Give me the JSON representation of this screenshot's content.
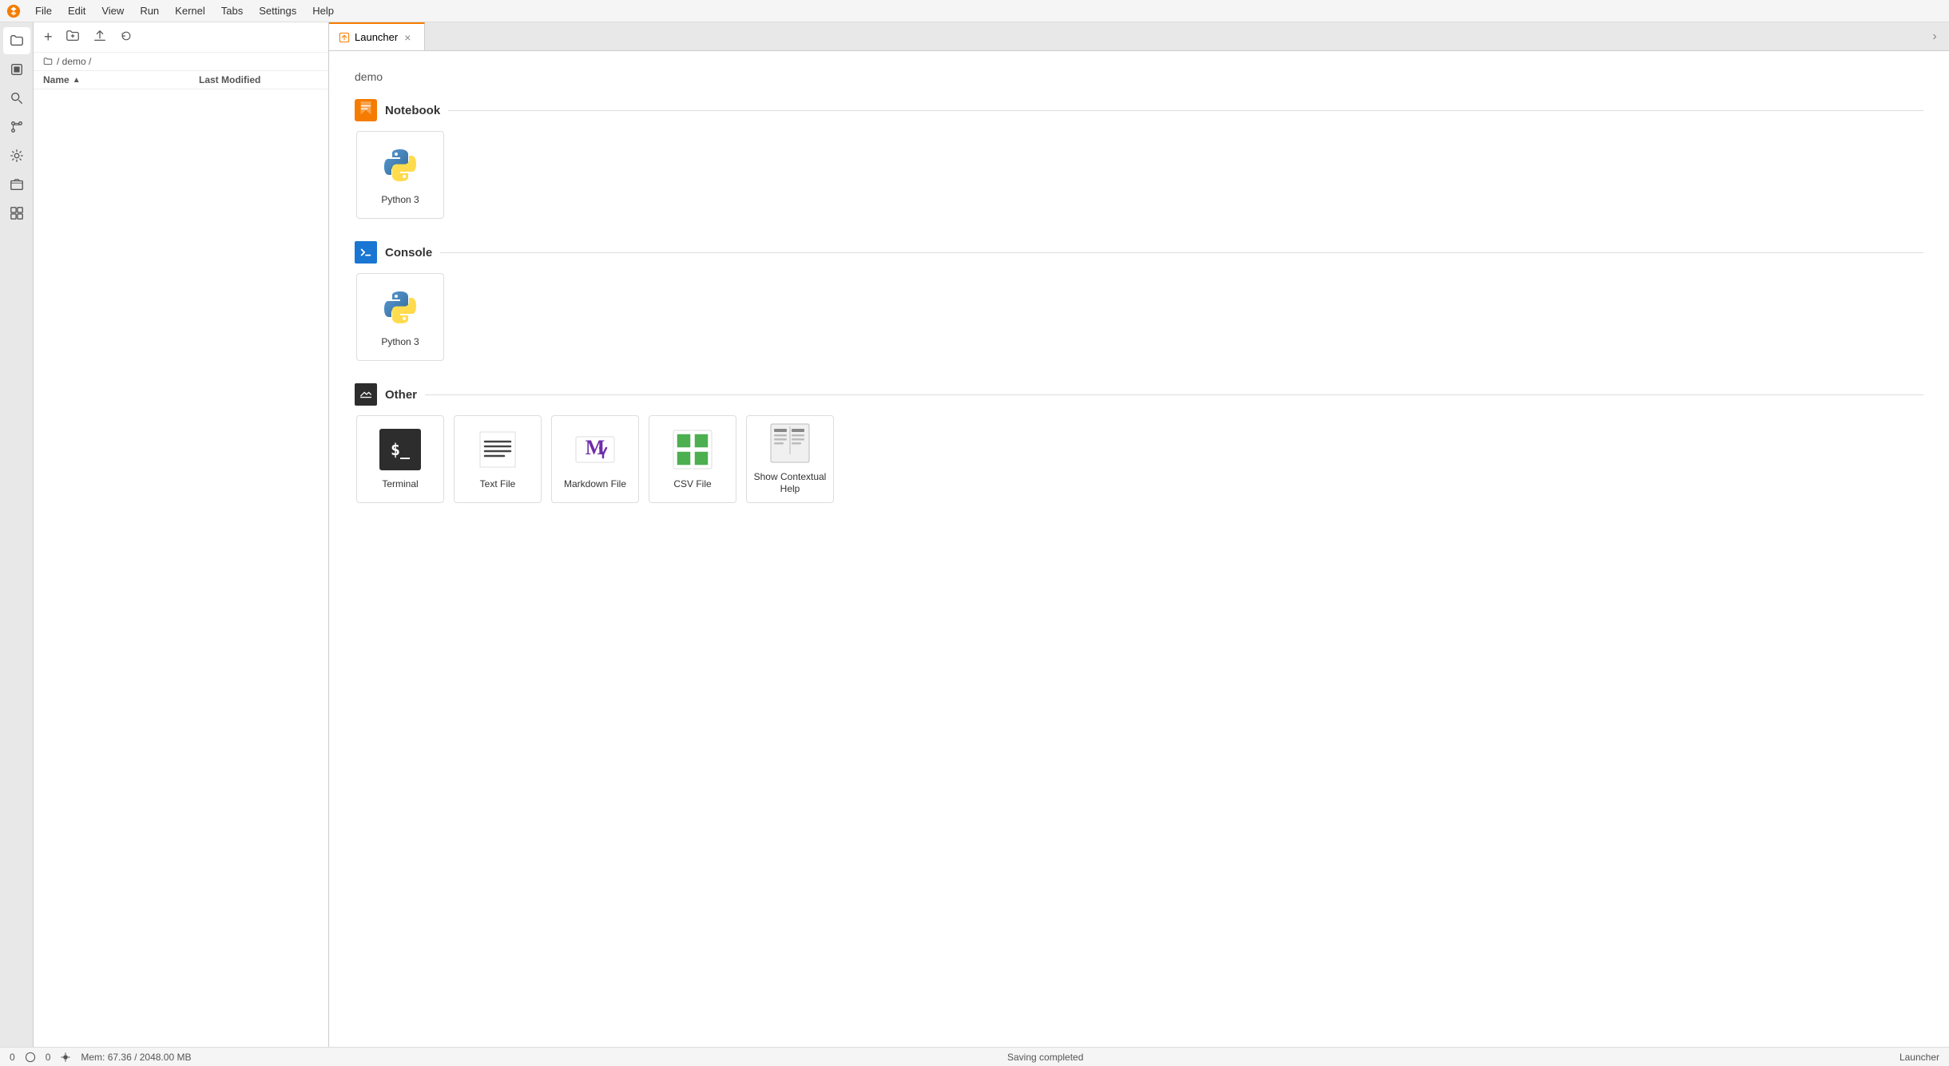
{
  "menubar": {
    "items": [
      "File",
      "Edit",
      "View",
      "Run",
      "Kernel",
      "Tabs",
      "Settings",
      "Help"
    ]
  },
  "sidebar": {
    "icons": [
      {
        "name": "folder-icon",
        "symbol": "📁",
        "active": true
      },
      {
        "name": "running-icon",
        "symbol": "⏹"
      },
      {
        "name": "search-icon",
        "symbol": "🔍"
      },
      {
        "name": "extension-icon",
        "symbol": "🔧"
      },
      {
        "name": "settings-icon",
        "symbol": "⚙"
      },
      {
        "name": "folder-open-icon",
        "symbol": "📂"
      },
      {
        "name": "puzzle-icon",
        "symbol": "🧩"
      }
    ]
  },
  "filebrowser": {
    "toolbar": {
      "new_folder": "+",
      "upload": "↑",
      "refresh": "⟳"
    },
    "breadcrumb": "/ demo /",
    "columns": {
      "name": "Name",
      "modified": "Last Modified"
    }
  },
  "tabs": [
    {
      "label": "Launcher",
      "active": true
    }
  ],
  "launcher": {
    "path": "demo",
    "sections": [
      {
        "id": "notebook",
        "title": "Notebook",
        "items": [
          {
            "id": "python3-notebook",
            "label": "Python 3"
          }
        ]
      },
      {
        "id": "console",
        "title": "Console",
        "items": [
          {
            "id": "python3-console",
            "label": "Python 3"
          }
        ]
      },
      {
        "id": "other",
        "title": "Other",
        "items": [
          {
            "id": "terminal",
            "label": "Terminal"
          },
          {
            "id": "textfile",
            "label": "Text File"
          },
          {
            "id": "markdown",
            "label": "Markdown File"
          },
          {
            "id": "csv",
            "label": "CSV File"
          },
          {
            "id": "contextual-help",
            "label": "Show Contextual Help"
          }
        ]
      }
    ]
  },
  "statusbar": {
    "left": [
      "0",
      "0"
    ],
    "memory": "Mem: 67.36 / 2048.00 MB",
    "status": "Saving completed",
    "right": "Launcher"
  }
}
